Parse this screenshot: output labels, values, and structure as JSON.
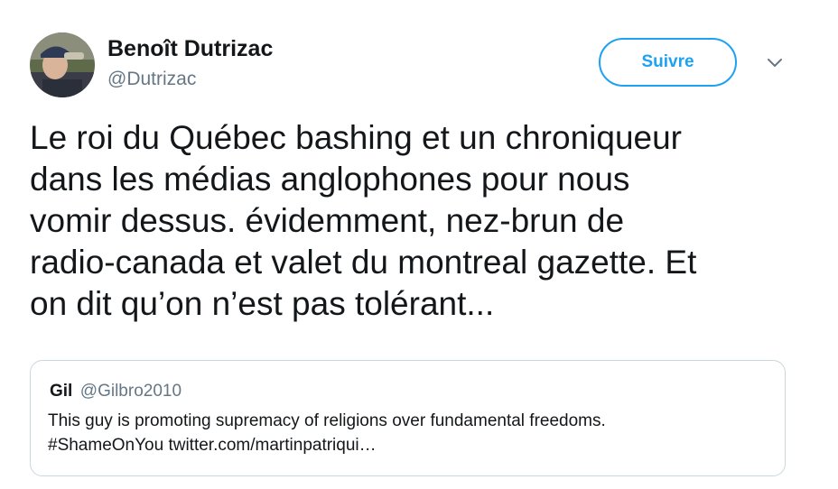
{
  "author": {
    "name": "Benoît Dutrizac",
    "handle": "@Dutrizac"
  },
  "follow_button": {
    "label": "Suivre"
  },
  "colors": {
    "accent": "#1da1f2",
    "secondary_text": "#657786",
    "border": "#ccd6dd"
  },
  "icons": {
    "menu": "chevron-down-icon",
    "avatar": "avatar"
  },
  "tweet": {
    "text_lines": [
      "Le roi du Québec bashing et un chroniqueur",
      "dans les médias anglophones pour nous",
      "vomir dessus. évidemment, nez-brun de",
      "radio-canada et valet du montreal gazette. Et",
      "on dit qu’on n’est pas tolérant..."
    ]
  },
  "quoted_tweet": {
    "name": "Gil",
    "handle": "@Gilbro2010",
    "text_lines": [
      "This guy is promoting supremacy of religions over fundamental freedoms.",
      "#ShameOnYou twitter.com/martinpatriqui…"
    ]
  }
}
